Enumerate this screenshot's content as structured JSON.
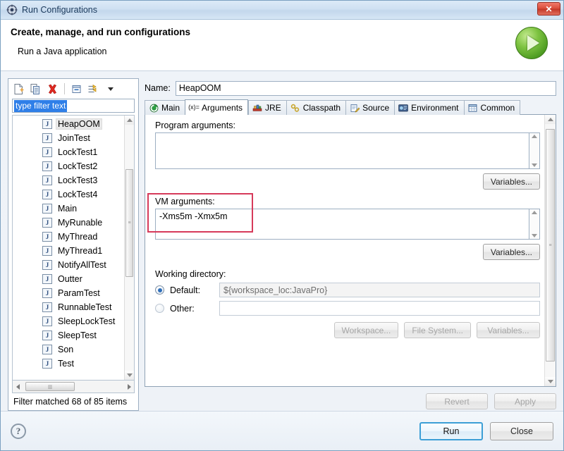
{
  "window": {
    "title": "Run Configurations",
    "title_icon": "run-configurations-icon",
    "close_label": "✕"
  },
  "header": {
    "title": "Create, manage, and run configurations",
    "subtitle": "Run a Java application",
    "badge_icon": "green-run-arrow-icon"
  },
  "left_panel": {
    "toolbar": [
      {
        "name": "new-configuration-icon",
        "tooltip": "New launch configuration"
      },
      {
        "name": "duplicate-configuration-icon",
        "tooltip": "Duplicate currently selected launch configuration"
      },
      {
        "name": "delete-configuration-icon",
        "tooltip": "Delete selected launch configuration(s)"
      },
      {
        "name": "collapse-all-icon",
        "tooltip": "Collapse All"
      },
      {
        "name": "filter-icon",
        "tooltip": "Filter launch configurations"
      },
      {
        "name": "chevron-down-icon",
        "tooltip": "View Menu"
      }
    ],
    "filter": {
      "value": "type filter text",
      "placeholder": "type filter text",
      "selected": true
    },
    "items": [
      {
        "label": "HeapOOM",
        "selected": true
      },
      {
        "label": "JoinTest",
        "selected": false
      },
      {
        "label": "LockTest1",
        "selected": false
      },
      {
        "label": "LockTest2",
        "selected": false
      },
      {
        "label": "LockTest3",
        "selected": false
      },
      {
        "label": "LockTest4",
        "selected": false
      },
      {
        "label": "Main",
        "selected": false
      },
      {
        "label": "MyRunable",
        "selected": false
      },
      {
        "label": "MyThread",
        "selected": false
      },
      {
        "label": "MyThread1",
        "selected": false
      },
      {
        "label": "NotifyAllTest",
        "selected": false
      },
      {
        "label": "Outter",
        "selected": false
      },
      {
        "label": "ParamTest",
        "selected": false
      },
      {
        "label": "RunnableTest",
        "selected": false
      },
      {
        "label": "SleepLockTest",
        "selected": false
      },
      {
        "label": "SleepTest",
        "selected": false
      },
      {
        "label": "Son",
        "selected": false
      },
      {
        "label": "Test",
        "selected": false
      }
    ],
    "item_icon": "java-class-icon",
    "status": "Filter matched 68 of 85 items"
  },
  "right_panel": {
    "name_label": "Name:",
    "name_value": "HeapOOM",
    "tabs": [
      {
        "label": "Main",
        "icon": "main-tab-icon",
        "active": false
      },
      {
        "label": "Arguments",
        "icon": "arguments-tab-icon",
        "active": true
      },
      {
        "label": "JRE",
        "icon": "jre-tab-icon",
        "active": false
      },
      {
        "label": "Classpath",
        "icon": "classpath-tab-icon",
        "active": false
      },
      {
        "label": "Source",
        "icon": "source-tab-icon",
        "active": false
      },
      {
        "label": "Environment",
        "icon": "environment-tab-icon",
        "active": false
      },
      {
        "label": "Common",
        "icon": "common-tab-icon",
        "active": false
      }
    ],
    "program_arguments": {
      "label": "Program arguments:",
      "value": "",
      "variables_button": "Variables..."
    },
    "vm_arguments": {
      "label": "VM arguments:",
      "value": "-Xms5m -Xmx5m",
      "variables_button": "Variables...",
      "highlight_color": "#d63a5a",
      "highlighted": true
    },
    "working_directory": {
      "label": "Working directory:",
      "default_label": "Default:",
      "default_value": "${workspace_loc:JavaPro}",
      "default_selected": true,
      "other_label": "Other:",
      "other_value": "",
      "other_selected": false,
      "buttons": [
        {
          "label": "Workspace...",
          "enabled": false
        },
        {
          "label": "File System...",
          "enabled": false
        },
        {
          "label": "Variables...",
          "enabled": false
        }
      ]
    },
    "revert_button": {
      "label": "Revert",
      "enabled": false
    },
    "apply_button": {
      "label": "Apply",
      "enabled": false
    }
  },
  "footer": {
    "help_icon": "help-question-icon",
    "help_glyph": "?",
    "run_button": {
      "label": "Run",
      "is_default": true
    },
    "close_button": {
      "label": "Close",
      "is_default": false
    }
  }
}
